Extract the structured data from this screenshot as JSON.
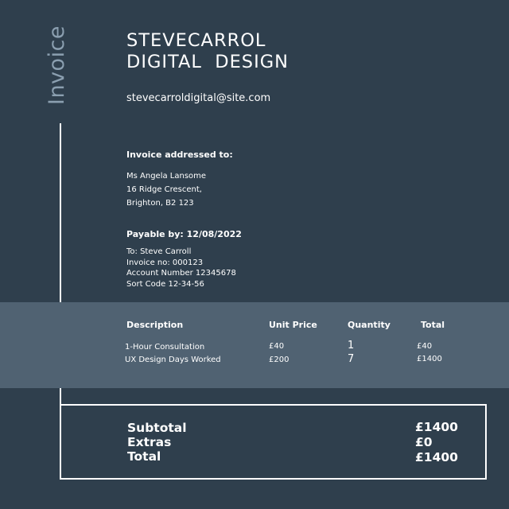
{
  "side_label": "Invoice",
  "brand": {
    "line1": "STEVECARROL",
    "line2": "DIGITAL  DESIGN"
  },
  "email": "stevecarroldigital@site.com",
  "addressed": {
    "heading": "Invoice addressed to:",
    "lines": [
      "Ms Angela Lansome",
      "16 Ridge Crescent,",
      "Brighton, B2 123"
    ]
  },
  "payable": {
    "heading": "Payable by: 12/08/2022",
    "lines": [
      "To: Steve Carroll",
      "Invoice no: 000123",
      "Account Number 12345678",
      "Sort Code 12-34-56"
    ]
  },
  "table": {
    "headers": {
      "description": "Description",
      "unit_price": "Unit Price",
      "quantity": "Quantity",
      "total": "Total"
    },
    "rows": [
      {
        "description": "1-Hour Consultation",
        "unit_price": "£40",
        "quantity": "1",
        "total": "£40"
      },
      {
        "description": "UX Design Days Worked",
        "unit_price": "£200",
        "quantity": "7",
        "total": "£1400"
      }
    ]
  },
  "totals": {
    "subtotal_label": "Subtotal",
    "subtotal_value": "£1400",
    "extras_label": "Extras",
    "extras_value": "£0",
    "total_label": "Total",
    "total_value": "£1400"
  },
  "colors": {
    "background": "#2f3f4d",
    "band": "#506272",
    "side_label": "#8b9fb0",
    "text": "#ffffff"
  }
}
